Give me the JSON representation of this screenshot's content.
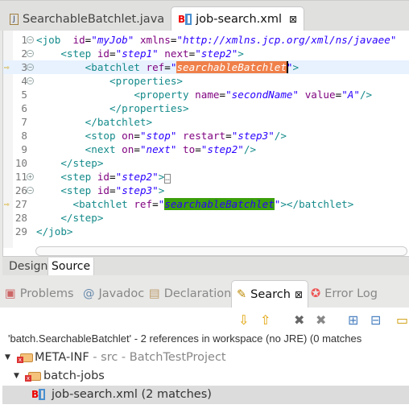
{
  "editor_tabs": [
    {
      "label": "SearchableBatchlet.java",
      "icon": "java-file-icon"
    },
    {
      "label": "job-search.xml",
      "icon": "xml-file-icon",
      "active": true
    }
  ],
  "code_lines": [
    {
      "n": "1",
      "fold": "minus",
      "tokens": [
        [
          "tag",
          "<job  "
        ],
        [
          "attr",
          "id"
        ],
        [
          "txt",
          "="
        ],
        [
          "val",
          "\"myJob\""
        ],
        [
          "txt",
          " "
        ],
        [
          "attr",
          "xmlns"
        ],
        [
          "txt",
          "="
        ],
        [
          "val",
          "\"http://xmlns.jcp.org/xml/ns/javaee\""
        ]
      ]
    },
    {
      "n": "2",
      "fold": "minus",
      "tokens": [
        [
          "txt",
          "    "
        ],
        [
          "tag",
          "<step "
        ],
        [
          "attr",
          "id"
        ],
        [
          "txt",
          "="
        ],
        [
          "val",
          "\"step1\""
        ],
        [
          "txt",
          " "
        ],
        [
          "attr",
          "next"
        ],
        [
          "txt",
          "="
        ],
        [
          "val",
          "\"step2\""
        ],
        [
          "tag",
          ">"
        ]
      ]
    },
    {
      "n": "3",
      "fold": "minus",
      "current": true,
      "marker": true,
      "tokens": [
        [
          "txt",
          "        "
        ],
        [
          "tag",
          "<batchlet "
        ],
        [
          "attr",
          "ref"
        ],
        [
          "txt",
          "="
        ],
        [
          "val",
          "\""
        ],
        [
          "hlo",
          "searchableBatchlet"
        ],
        [
          "val",
          "\""
        ],
        [
          "tag",
          ">"
        ]
      ]
    },
    {
      "n": "4",
      "fold": "minus",
      "tokens": [
        [
          "txt",
          "            "
        ],
        [
          "tag",
          "<properties>"
        ]
      ]
    },
    {
      "n": "5",
      "tokens": [
        [
          "txt",
          "                "
        ],
        [
          "tag",
          "<property "
        ],
        [
          "attr",
          "name"
        ],
        [
          "txt",
          "="
        ],
        [
          "val",
          "\"secondName\""
        ],
        [
          "txt",
          " "
        ],
        [
          "attr",
          "value"
        ],
        [
          "txt",
          "="
        ],
        [
          "val",
          "\"A\""
        ],
        [
          "tag",
          "/>"
        ]
      ]
    },
    {
      "n": "6",
      "tokens": [
        [
          "txt",
          "            "
        ],
        [
          "tag",
          "</properties>"
        ]
      ]
    },
    {
      "n": "7",
      "tokens": [
        [
          "txt",
          "        "
        ],
        [
          "tag",
          "</batchlet>"
        ]
      ]
    },
    {
      "n": "8",
      "tokens": [
        [
          "txt",
          "        "
        ],
        [
          "tag",
          "<stop "
        ],
        [
          "attr",
          "on"
        ],
        [
          "txt",
          "="
        ],
        [
          "val",
          "\"stop\""
        ],
        [
          "txt",
          " "
        ],
        [
          "attr",
          "restart"
        ],
        [
          "txt",
          "="
        ],
        [
          "val",
          "\"step3\""
        ],
        [
          "tag",
          "/>"
        ]
      ]
    },
    {
      "n": "9",
      "tokens": [
        [
          "txt",
          "        "
        ],
        [
          "tag",
          "<next "
        ],
        [
          "attr",
          "on"
        ],
        [
          "txt",
          "="
        ],
        [
          "val",
          "\"next\""
        ],
        [
          "txt",
          " "
        ],
        [
          "attr",
          "to"
        ],
        [
          "txt",
          "="
        ],
        [
          "val",
          "\"step2\""
        ],
        [
          "tag",
          "/>"
        ]
      ]
    },
    {
      "n": "10",
      "tokens": [
        [
          "txt",
          "    "
        ],
        [
          "tag",
          "</step>"
        ]
      ]
    },
    {
      "n": "11",
      "fold": "plus",
      "tokens": [
        [
          "txt",
          "    "
        ],
        [
          "tag",
          "<step "
        ],
        [
          "attr",
          "id"
        ],
        [
          "txt",
          "="
        ],
        [
          "val",
          "\"step2\""
        ],
        [
          "tag",
          ">"
        ],
        [
          "txt",
          "…"
        ]
      ]
    },
    {
      "n": "26",
      "fold": "minus",
      "tokens": [
        [
          "txt",
          "    "
        ],
        [
          "tag",
          "<step "
        ],
        [
          "attr",
          "id"
        ],
        [
          "txt",
          "="
        ],
        [
          "val",
          "\"step3\""
        ],
        [
          "tag",
          ">"
        ]
      ]
    },
    {
      "n": "27",
      "marker": true,
      "tokens": [
        [
          "txt",
          "      "
        ],
        [
          "tag",
          "<batchlet "
        ],
        [
          "attr",
          "ref"
        ],
        [
          "txt",
          "="
        ],
        [
          "val",
          "\""
        ],
        [
          "hlg",
          "searchableBatchlet"
        ],
        [
          "val",
          "\""
        ],
        [
          "tag",
          "></batchlet>"
        ]
      ]
    },
    {
      "n": "28",
      "tokens": [
        [
          "txt",
          "    "
        ],
        [
          "tag",
          "</step>"
        ]
      ]
    },
    {
      "n": "29",
      "tokens": [
        [
          "tag",
          "</job>"
        ]
      ]
    }
  ],
  "source_tabs": {
    "design": "Design",
    "source": "Source"
  },
  "panel_tabs": [
    {
      "label": "Problems"
    },
    {
      "label": "Javadoc"
    },
    {
      "label": "Declaration"
    },
    {
      "label": "Search",
      "active": true
    },
    {
      "label": "Error Log"
    }
  ],
  "search": {
    "message": "'batch.SearchableBatchlet' - 2 references in workspace (no JRE) (0 matches",
    "tree": [
      {
        "label": "META-INF",
        "suffix": " - src - BatchTestProject"
      },
      {
        "label": "batch-jobs"
      },
      {
        "label": "job-search.xml (2 matches)"
      }
    ]
  }
}
